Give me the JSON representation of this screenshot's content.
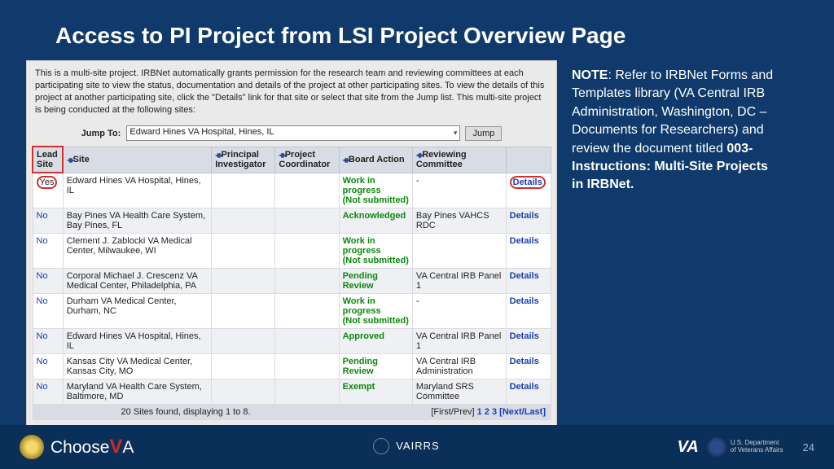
{
  "title": "Access to PI Project from LSI Project Overview Page",
  "panel": {
    "intro": "This is a multi-site project. IRBNet automatically grants permission for the research team and reviewing committees at each participating site to view the status, documentation and details of the project at other participating sites. To view the details of this project at another participating site, click the \"Details\" link for that site or select that site from the Jump list. This multi-site project is being conducted at the following sites:",
    "jump_label": "Jump To:",
    "jump_value": "Edward Hines VA Hospital, Hines, IL",
    "jump_btn": "Jump",
    "headers": {
      "lead": "Lead Site",
      "site": "Site",
      "pi": "Principal Investigator",
      "pc": "Project Coordinator",
      "ba": "Board Action",
      "rc": "Reviewing Committee"
    },
    "rows": [
      {
        "lead": "Yes",
        "site": "Edward Hines VA Hospital, Hines, IL",
        "pi": "",
        "pc": "",
        "ba": "Work in progress",
        "ba2": "(Not submitted)",
        "rc": "-",
        "det": "Details"
      },
      {
        "lead": "No",
        "site": "Bay Pines VA Health Care System, Bay Pines, FL",
        "pi": "",
        "pc": "",
        "ba": "Acknowledged",
        "ba2": "",
        "rc": "Bay Pines VAHCS RDC",
        "det": "Details"
      },
      {
        "lead": "No",
        "site": "Clement J. Zablocki VA Medical Center, Milwaukee, WI",
        "pi": "",
        "pc": "",
        "ba": "Work in progress",
        "ba2": "(Not submitted)",
        "rc": "",
        "det": "Details"
      },
      {
        "lead": "No",
        "site": "Corporal Michael J. Crescenz VA Medical Center, Philadelphia, PA",
        "pi": "",
        "pc": "",
        "ba": "Pending Review",
        "ba2": "",
        "rc": "VA Central IRB Panel 1",
        "det": "Details"
      },
      {
        "lead": "No",
        "site": "Durham VA Medical Center, Durham, NC",
        "pi": "",
        "pc": "",
        "ba": "Work in progress",
        "ba2": "(Not submitted)",
        "rc": "-",
        "det": "Details"
      },
      {
        "lead": "No",
        "site": "Edward Hines VA Hospital, Hines, IL",
        "pi": "",
        "pc": "",
        "ba": "Approved",
        "ba2": "",
        "rc": "VA Central IRB Panel 1",
        "det": "Details"
      },
      {
        "lead": "No",
        "site": "Kansas City VA Medical Center, Kansas City, MO",
        "pi": "",
        "pc": "",
        "ba": "Pending Review",
        "ba2": "",
        "rc": "VA Central IRB Administration",
        "det": "Details"
      },
      {
        "lead": "No",
        "site": "Maryland VA Health Care System, Baltimore, MD",
        "pi": "",
        "pc": "",
        "ba": "Exempt",
        "ba2": "",
        "rc": "Maryland SRS Committee",
        "det": "Details"
      }
    ],
    "pager_label": "20 Sites found, displaying 1 to 8.",
    "pager_first": "[First/Prev]",
    "pager_1": "1",
    "pager_2": "2",
    "pager_3": "3",
    "pager_next": "[Next/Last]"
  },
  "note": {
    "prefix": "NOTE",
    "body1": ": Refer to IRBNet Forms and Templates library (VA Central IRB Administration, Washington, DC – Documents for Researchers) and review the document titled ",
    "bold2": "003-Instructions: Multi-Site Projects in IRBNet."
  },
  "footer": {
    "choose1": "Choose",
    "chooseV": "V",
    "chooseA": "A",
    "vairrs": "VAIRRS",
    "va": "VA",
    "dept1": "U.S. Department",
    "dept2": "of Veterans Affairs",
    "page": "24"
  }
}
